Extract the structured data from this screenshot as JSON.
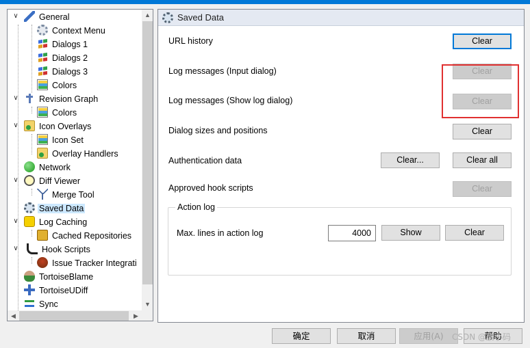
{
  "tree": {
    "items": [
      {
        "label": "General",
        "icon": "wrench-icon"
      },
      {
        "label": "Context Menu",
        "icon": "gear-icon"
      },
      {
        "label": "Dialogs 1",
        "icon": "windows-icon"
      },
      {
        "label": "Dialogs 2",
        "icon": "windows-icon"
      },
      {
        "label": "Dialogs 3",
        "icon": "windows-icon"
      },
      {
        "label": "Colors",
        "icon": "palette-icon"
      },
      {
        "label": "Revision Graph",
        "icon": "revision-graph-icon"
      },
      {
        "label": "Colors",
        "icon": "palette-icon"
      },
      {
        "label": "Icon Overlays",
        "icon": "overlay-icon"
      },
      {
        "label": "Icon Set",
        "icon": "palette-icon"
      },
      {
        "label": "Overlay Handlers",
        "icon": "overlay-icon"
      },
      {
        "label": "Network",
        "icon": "globe-icon"
      },
      {
        "label": "Diff Viewer",
        "icon": "magnifier-icon"
      },
      {
        "label": "Merge Tool",
        "icon": "merge-icon"
      },
      {
        "label": "Saved Data",
        "icon": "saved-data-icon"
      },
      {
        "label": "Log Caching",
        "icon": "log-cache-icon"
      },
      {
        "label": "Cached Repositories",
        "icon": "cached-repo-icon"
      },
      {
        "label": "Hook Scripts",
        "icon": "hook-icon"
      },
      {
        "label": "Issue Tracker Integrati",
        "icon": "bug-icon"
      },
      {
        "label": "TortoiseBlame",
        "icon": "blame-icon"
      },
      {
        "label": "TortoiseUDiff",
        "icon": "udiff-icon"
      },
      {
        "label": "Sync",
        "icon": "sync-icon"
      }
    ]
  },
  "panel": {
    "title": "Saved Data",
    "rows": {
      "url_history": "URL history",
      "log_input": "Log messages (Input dialog)",
      "log_show": "Log messages (Show log dialog)",
      "dialog_sizes": "Dialog sizes and positions",
      "auth_data": "Authentication data",
      "hook_scripts": "Approved hook scripts"
    },
    "buttons": {
      "clear": "Clear",
      "clear_dots": "Clear...",
      "clear_all": "Clear all",
      "show": "Show"
    },
    "action_log": {
      "legend": "Action log",
      "max_lines_label": "Max. lines in action log",
      "max_lines_value": "4000"
    }
  },
  "footer": {
    "ok": "确定",
    "cancel": "取消",
    "apply": "应用(A)",
    "help": "帮助",
    "watermark": "CSDN @鹏小码"
  },
  "colors": {
    "accent": "#0078d7",
    "selection": "#cce8ff",
    "highlight": "#e03030"
  }
}
